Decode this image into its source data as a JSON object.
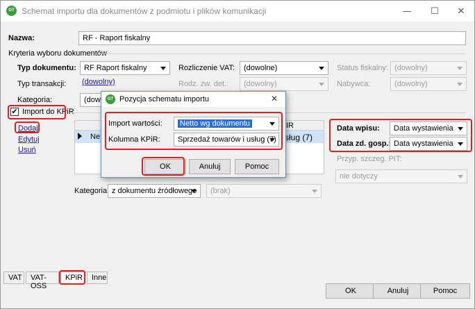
{
  "window": {
    "title": "Schemat importu dla dokumentów z podmiotu i plików komunikacji",
    "icon_text": "GT"
  },
  "form": {
    "nazwa_label": "Nazwa:",
    "nazwa_value": "RF - Raport fiskalny",
    "kryteria_label": "Kryteria wyboru dokumentów",
    "typ_dokumentu_label": "Typ dokumentu:",
    "typ_dokumentu_value": "RF Raport fiskalny",
    "rozliczenie_vat_label": "Rozliczenie VAT:",
    "rozliczenie_vat_value": "(dowolne)",
    "status_fiskalny_label": "Status fiskalny:",
    "status_fiskalny_value": "(dowolny)",
    "typ_transakcji_label": "Typ transakcji:",
    "typ_transakcji_value": "(dowolny)",
    "rodz_zw_det_label": "Rodz. zw. det.:",
    "rodz_zw_det_value": "(dowolny)",
    "nabywca_label": "Nabywca:",
    "nabywca_value": "(dowolny)",
    "kategoria_label": "Kategoria:",
    "kategoria_value": "(dowolny)",
    "import_kpir_label": "Import do KPiR",
    "import_kpir_checked": true,
    "dodaj_label": "Dodaj",
    "edytuj_label": "Edytuj",
    "usun_label": "Usuń",
    "grid_header_partial": "IR",
    "grid_row_left": "Ne",
    "grid_row_right": "sług (7)",
    "data_wpisu_label": "Data wpisu:",
    "data_wpisu_value": "Data wystawienia",
    "data_zd_label": "Data zd. gosp.:",
    "data_zd_value": "Data wystawienia",
    "przyp_label": "Przyp. szczeg. PIT:",
    "przyp_value": "nie dotyczy",
    "kategoria2_label": "Kategoria:",
    "kategoria2_value": "z dokumentu źródłowego",
    "kategoria2_sub_value": "(brak)"
  },
  "tabs": [
    "VAT",
    "VAT-OSS",
    "KPiR",
    "Inne"
  ],
  "active_tab": "KPiR",
  "buttons": {
    "ok": "OK",
    "anuluj": "Anuluj",
    "pomoc": "Pomoc"
  },
  "dialog": {
    "title": "Pozycja schematu importu",
    "import_wartosci_label": "Import wartości:",
    "import_wartosci_value": "Netto wg dokumentu",
    "kolumna_kpir_label": "Kolumna KPiR:",
    "kolumna_kpir_value": "Sprzedaż towarów i usług (7)",
    "ok": "OK",
    "anuluj": "Anuluj",
    "pomoc": "Pomoc"
  },
  "colors": {
    "highlight": "#e02020",
    "selection": "#2a6fd6",
    "app_icon": "#3d9a3d"
  }
}
